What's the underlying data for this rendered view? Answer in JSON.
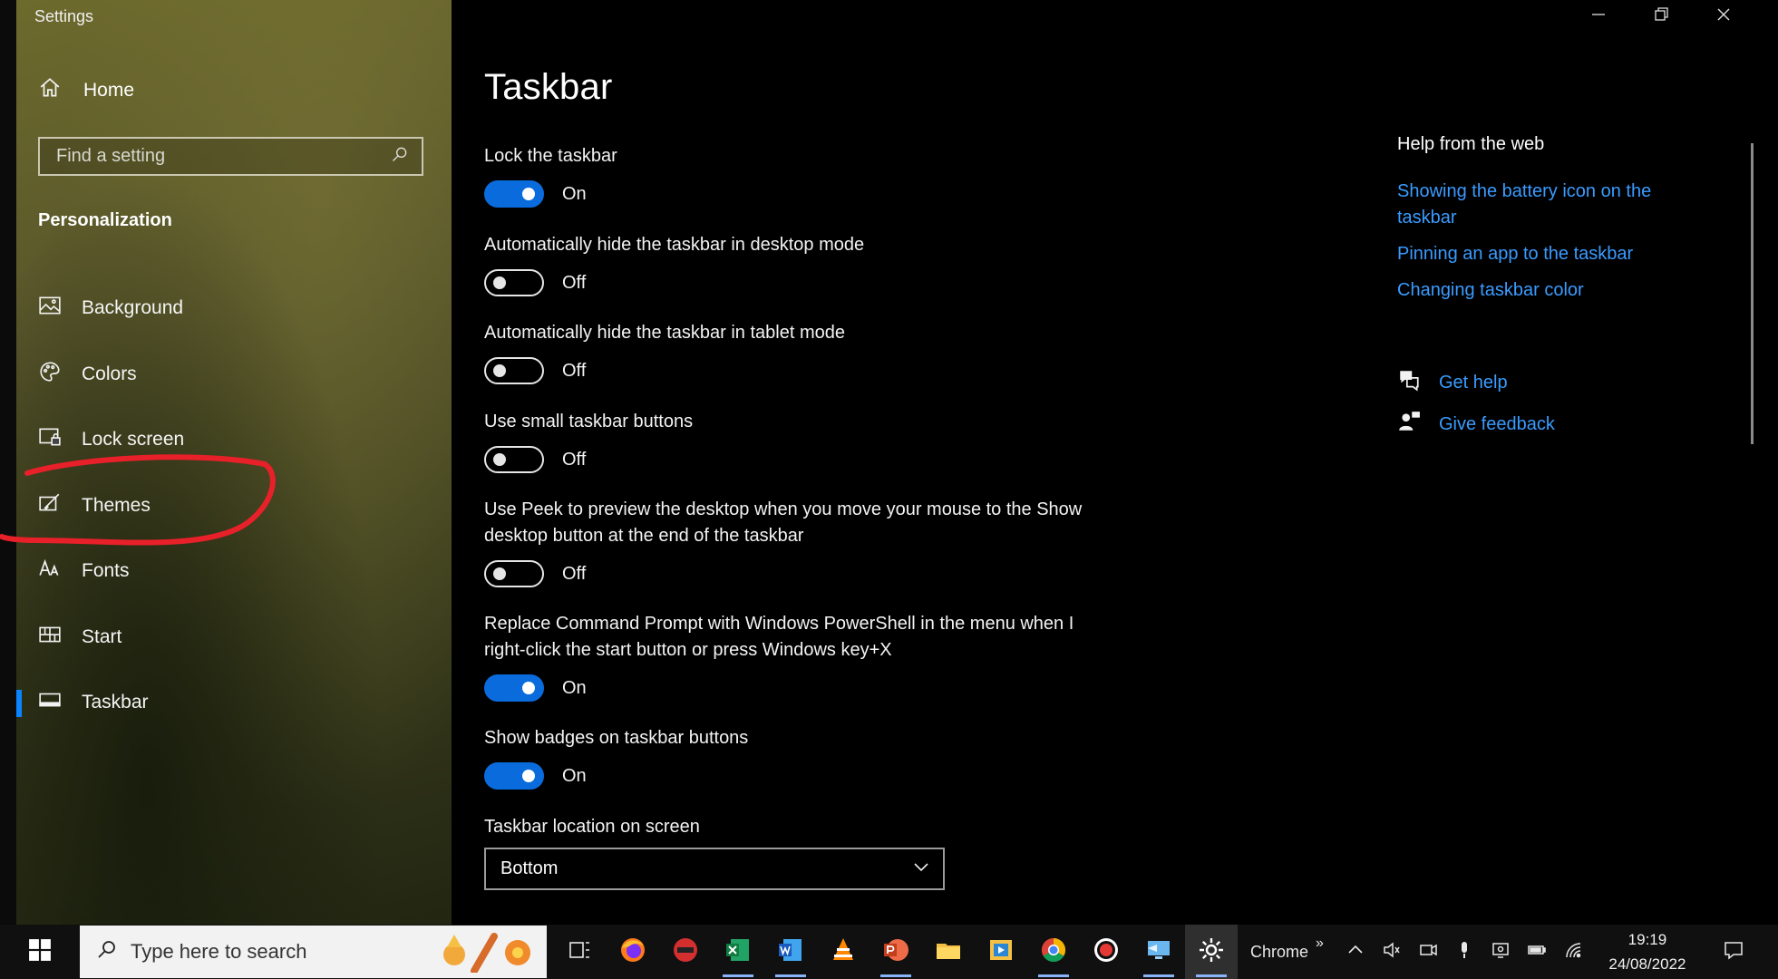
{
  "window": {
    "title": "Settings",
    "controls": [
      "minimize-icon",
      "restore-icon",
      "close-icon"
    ]
  },
  "sidebar": {
    "home_label": "Home",
    "search_placeholder": "Find a setting",
    "section_heading": "Personalization",
    "items": [
      {
        "label": "Background",
        "icon": "picture-icon"
      },
      {
        "label": "Colors",
        "icon": "palette-icon"
      },
      {
        "label": "Lock screen",
        "icon": "lock-screen-icon"
      },
      {
        "label": "Themes",
        "icon": "brush-icon"
      },
      {
        "label": "Fonts",
        "icon": "font-icon"
      },
      {
        "label": "Start",
        "icon": "start-grid-icon"
      },
      {
        "label": "Taskbar",
        "icon": "taskbar-icon",
        "selected": true
      }
    ]
  },
  "main": {
    "title": "Taskbar",
    "settings": [
      {
        "label": "Lock the taskbar",
        "state": "On"
      },
      {
        "label": "Automatically hide the taskbar in desktop mode",
        "state": "Off"
      },
      {
        "label": "Automatically hide the taskbar in tablet mode",
        "state": "Off"
      },
      {
        "label": "Use small taskbar buttons",
        "state": "Off"
      },
      {
        "label": "Use Peek to preview the desktop when you move your mouse to the Show desktop button at the end of the taskbar",
        "state": "Off"
      },
      {
        "label": "Replace Command Prompt with Windows PowerShell in the menu when I right-click the start button or press Windows key+X",
        "state": "On"
      },
      {
        "label": "Show badges on taskbar buttons",
        "state": "On"
      }
    ],
    "location": {
      "label": "Taskbar location on screen",
      "value": "Bottom"
    }
  },
  "help": {
    "title": "Help from the web",
    "links": [
      "Showing the battery icon on the taskbar",
      "Pinning an app to the taskbar",
      "Changing taskbar color"
    ],
    "get_help": "Get help",
    "give_feedback": "Give feedback"
  },
  "taskbar": {
    "search_placeholder": "Type here to search",
    "apps": [
      "task-view-icon",
      "firefox-icon",
      "record-app-icon",
      "excel-icon",
      "word-icon",
      "vlc-icon",
      "powerpoint-icon",
      "file-explorer-icon",
      "media-icon",
      "chrome-icon",
      "recorder-icon",
      "remote-desktop-icon",
      "settings-gear-icon"
    ],
    "active_label": "Chrome",
    "overflow": "»",
    "time": "19:19",
    "date": "24/08/2022"
  },
  "colors": {
    "accent": "#0a6cdc",
    "link": "#3a9bff",
    "annotation": "#e8202a"
  }
}
